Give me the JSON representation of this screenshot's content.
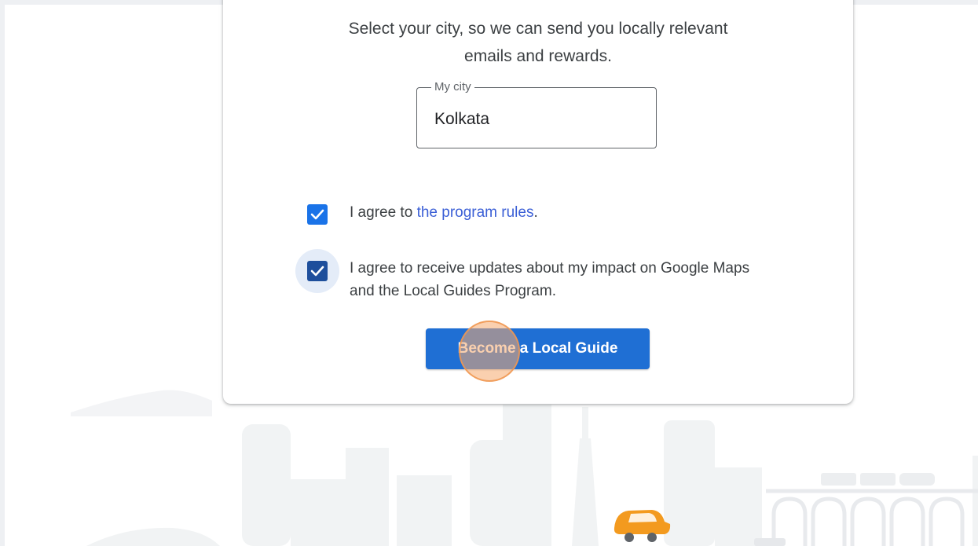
{
  "intro": {
    "line1": "Select your city, so we can send you locally relevant",
    "line2": "emails and rewards."
  },
  "city_field": {
    "label": "My city",
    "value": "Kolkata"
  },
  "rules_agreement": {
    "checked": true,
    "prefix": "I agree to ",
    "link_text": "the program rules",
    "suffix": "."
  },
  "updates_agreement": {
    "checked": true,
    "line1": "I agree to receive updates about my impact on Google Maps",
    "line2": "and the Local Guides Program."
  },
  "cta": {
    "label": "Become a Local Guide"
  },
  "colors": {
    "primary": "#1f6fd4",
    "checkbox": "#1a73e8",
    "checkbox_focused": "#1e4f9c",
    "link": "#3b5fd6",
    "car": "#f39a1f",
    "skyline": "#f1f3f4"
  }
}
